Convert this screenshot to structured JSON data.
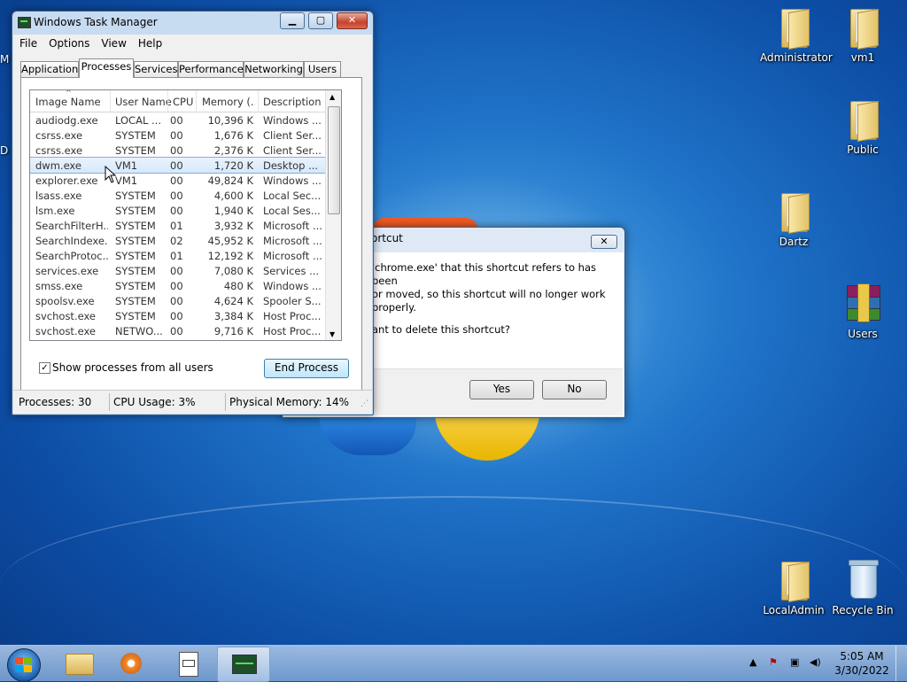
{
  "desktop": {
    "left_edge_letters": [
      "M",
      "D"
    ],
    "icons": [
      {
        "label": "Administrator",
        "type": "folder"
      },
      {
        "label": "vm1",
        "type": "folder"
      },
      {
        "label": "Public",
        "type": "folder"
      },
      {
        "label": "Dartz",
        "type": "folder"
      },
      {
        "label": "Users",
        "type": "winrar"
      },
      {
        "label": "LocalAdmin",
        "type": "folder"
      },
      {
        "label": "Recycle Bin",
        "type": "recycle-bin"
      }
    ]
  },
  "dialog": {
    "title": "ortcut",
    "message_line1": "'chrome.exe' that this shortcut refers to has been",
    "message_line2": "or moved, so this shortcut will no longer work properly.",
    "question": "ant to delete this shortcut?",
    "yes_label": "Yes",
    "no_label": "No",
    "close_icon": "close-icon"
  },
  "task_manager": {
    "title": "Windows Task Manager",
    "menu": [
      "File",
      "Options",
      "View",
      "Help"
    ],
    "tabs": [
      "Applications",
      "Processes",
      "Services",
      "Performance",
      "Networking",
      "Users"
    ],
    "active_tab": "Processes",
    "columns": [
      "Image Name",
      "User Name",
      "CPU",
      "Memory (...",
      "Description"
    ],
    "rows": [
      {
        "name": "audiodg.exe",
        "user": "LOCAL ...",
        "cpu": "00",
        "mem": "10,396 K",
        "desc": "Windows ..."
      },
      {
        "name": "csrss.exe",
        "user": "SYSTEM",
        "cpu": "00",
        "mem": "1,676 K",
        "desc": "Client Ser..."
      },
      {
        "name": "csrss.exe",
        "user": "SYSTEM",
        "cpu": "00",
        "mem": "2,376 K",
        "desc": "Client Ser..."
      },
      {
        "name": "dwm.exe",
        "user": "VM1",
        "cpu": "00",
        "mem": "1,720 K",
        "desc": "Desktop ..."
      },
      {
        "name": "explorer.exe",
        "user": "VM1",
        "cpu": "00",
        "mem": "49,824 K",
        "desc": "Windows ..."
      },
      {
        "name": "lsass.exe",
        "user": "SYSTEM",
        "cpu": "00",
        "mem": "4,600 K",
        "desc": "Local Sec..."
      },
      {
        "name": "lsm.exe",
        "user": "SYSTEM",
        "cpu": "00",
        "mem": "1,940 K",
        "desc": "Local Ses..."
      },
      {
        "name": "SearchFilterH...",
        "user": "SYSTEM",
        "cpu": "01",
        "mem": "3,932 K",
        "desc": "Microsoft ..."
      },
      {
        "name": "SearchIndexe...",
        "user": "SYSTEM",
        "cpu": "02",
        "mem": "45,952 K",
        "desc": "Microsoft ..."
      },
      {
        "name": "SearchProtoc...",
        "user": "SYSTEM",
        "cpu": "01",
        "mem": "12,192 K",
        "desc": "Microsoft ..."
      },
      {
        "name": "services.exe",
        "user": "SYSTEM",
        "cpu": "00",
        "mem": "7,080 K",
        "desc": "Services ..."
      },
      {
        "name": "smss.exe",
        "user": "SYSTEM",
        "cpu": "00",
        "mem": "480 K",
        "desc": "Windows ..."
      },
      {
        "name": "spoolsv.exe",
        "user": "SYSTEM",
        "cpu": "00",
        "mem": "4,624 K",
        "desc": "Spooler S..."
      },
      {
        "name": "svchost.exe",
        "user": "SYSTEM",
        "cpu": "00",
        "mem": "3,384 K",
        "desc": "Host Proc..."
      },
      {
        "name": "svchost.exe",
        "user": "NETWO...",
        "cpu": "00",
        "mem": "9,716 K",
        "desc": "Host Proc..."
      }
    ],
    "selected_row": 3,
    "show_all_label": "Show processes from all users",
    "show_all_checked": true,
    "end_process_label": "End Process",
    "status": {
      "processes": "Processes: 30",
      "cpu": "CPU Usage: 3%",
      "memory": "Physical Memory: 14%"
    }
  },
  "taskbar": {
    "items": [
      "start-orb",
      "windows-explorer",
      "media-player",
      "notepad-app",
      "task-manager-app"
    ],
    "tray_icons": [
      "show-hidden-icons-icon",
      "action-center-flag-icon",
      "network-icon",
      "volume-icon"
    ],
    "time": "5:05 AM",
    "date": "3/30/2022"
  },
  "colors": {
    "desktop_blue": "#1f73c9",
    "selection": "#d6e8fb",
    "window_frame": "#c7dbf1",
    "close_red": "#c4422c"
  }
}
